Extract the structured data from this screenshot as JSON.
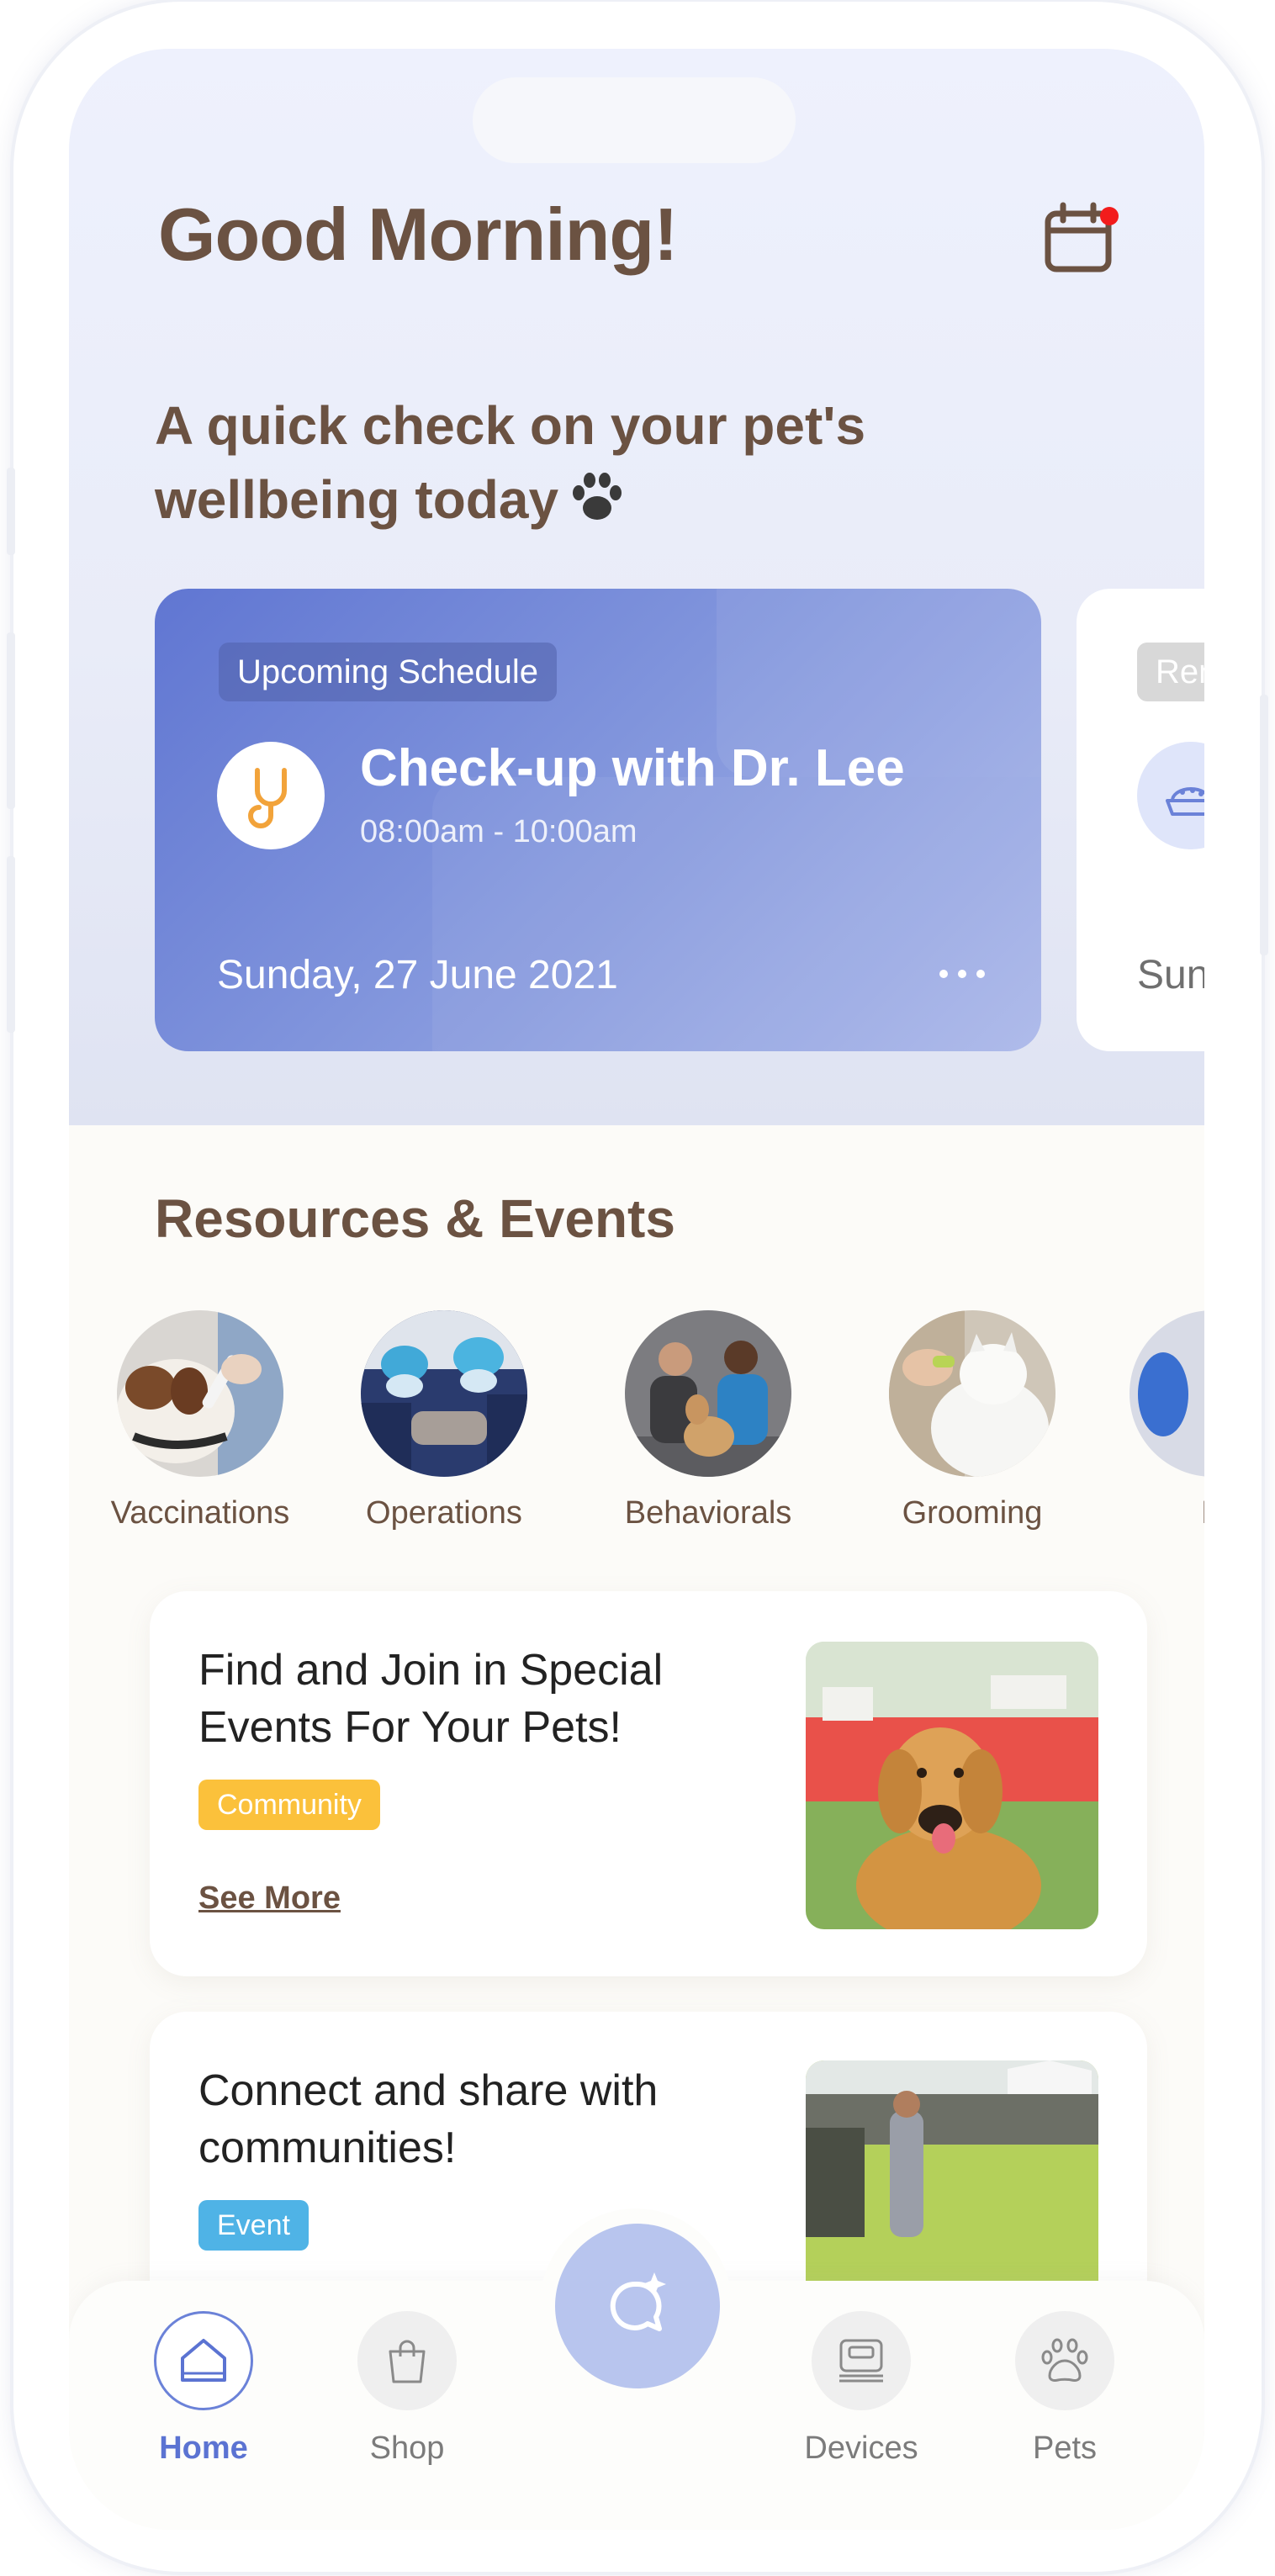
{
  "colors": {
    "brand_brown": "#6b5242",
    "accent_blue": "#6076d2",
    "notification": "#f21c1c",
    "community_tag": "#fbc13b",
    "event_tag": "#4fb3e6"
  },
  "header": {
    "greeting": "Good Morning!",
    "calendar_icon": "calendar-icon",
    "has_notification": true
  },
  "subtitle": {
    "line1": "A quick check on your pet's",
    "line2": "wellbeing today"
  },
  "schedule_cards": [
    {
      "chip": "Upcoming Schedule",
      "title": "Check-up with Dr. Lee",
      "time": "08:00am - 10:00am",
      "date": "Sunday, 27 June 2021",
      "icon": "stethoscope-icon"
    },
    {
      "chip": "Rem",
      "date": "Sun",
      "icon": "food-bowl-icon"
    }
  ],
  "resources": {
    "title": "Resources & Events",
    "categories": [
      {
        "label": "Vaccinations"
      },
      {
        "label": "Operations"
      },
      {
        "label": "Behaviorals"
      },
      {
        "label": "Grooming"
      },
      {
        "label": "D"
      }
    ]
  },
  "events": [
    {
      "title": "Find and Join in Special Events For Your Pets!",
      "tag": "Community",
      "link": "See More"
    },
    {
      "title": "Connect and share with communities!",
      "tag": "Event"
    }
  ],
  "tabbar": {
    "tabs": [
      {
        "label": "Home",
        "icon": "home-icon",
        "active": true
      },
      {
        "label": "Shop",
        "icon": "shopping-bag-icon",
        "active": false
      },
      {
        "label": "Devices",
        "icon": "device-icon",
        "active": false
      },
      {
        "label": "Pets",
        "icon": "paw-icon",
        "active": false
      }
    ],
    "center_action_icon": "chat-sparkle-icon"
  }
}
